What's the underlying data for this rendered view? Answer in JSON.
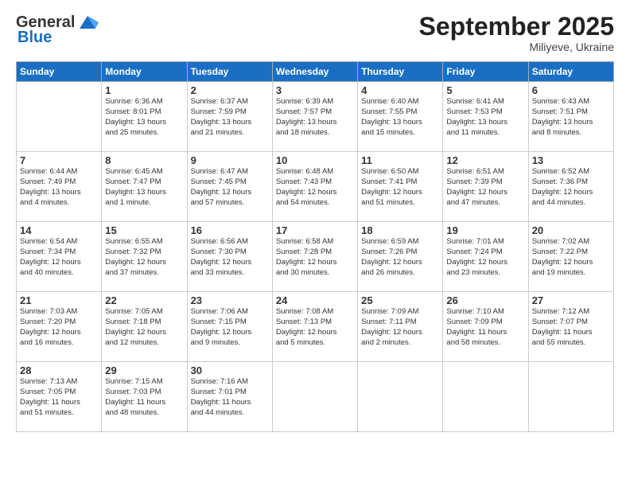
{
  "logo": {
    "general": "General",
    "blue": "Blue"
  },
  "title": "September 2025",
  "subtitle": "Miliyeve, Ukraine",
  "days": [
    "Sunday",
    "Monday",
    "Tuesday",
    "Wednesday",
    "Thursday",
    "Friday",
    "Saturday"
  ],
  "weeks": [
    [
      {
        "day": "",
        "info": ""
      },
      {
        "day": "1",
        "info": "Sunrise: 6:36 AM\nSunset: 8:01 PM\nDaylight: 13 hours\nand 25 minutes."
      },
      {
        "day": "2",
        "info": "Sunrise: 6:37 AM\nSunset: 7:59 PM\nDaylight: 13 hours\nand 21 minutes."
      },
      {
        "day": "3",
        "info": "Sunrise: 6:39 AM\nSunset: 7:57 PM\nDaylight: 13 hours\nand 18 minutes."
      },
      {
        "day": "4",
        "info": "Sunrise: 6:40 AM\nSunset: 7:55 PM\nDaylight: 13 hours\nand 15 minutes."
      },
      {
        "day": "5",
        "info": "Sunrise: 6:41 AM\nSunset: 7:53 PM\nDaylight: 13 hours\nand 11 minutes."
      },
      {
        "day": "6",
        "info": "Sunrise: 6:43 AM\nSunset: 7:51 PM\nDaylight: 13 hours\nand 8 minutes."
      }
    ],
    [
      {
        "day": "7",
        "info": "Sunrise: 6:44 AM\nSunset: 7:49 PM\nDaylight: 13 hours\nand 4 minutes."
      },
      {
        "day": "8",
        "info": "Sunrise: 6:45 AM\nSunset: 7:47 PM\nDaylight: 13 hours\nand 1 minute."
      },
      {
        "day": "9",
        "info": "Sunrise: 6:47 AM\nSunset: 7:45 PM\nDaylight: 12 hours\nand 57 minutes."
      },
      {
        "day": "10",
        "info": "Sunrise: 6:48 AM\nSunset: 7:43 PM\nDaylight: 12 hours\nand 54 minutes."
      },
      {
        "day": "11",
        "info": "Sunrise: 6:50 AM\nSunset: 7:41 PM\nDaylight: 12 hours\nand 51 minutes."
      },
      {
        "day": "12",
        "info": "Sunrise: 6:51 AM\nSunset: 7:39 PM\nDaylight: 12 hours\nand 47 minutes."
      },
      {
        "day": "13",
        "info": "Sunrise: 6:52 AM\nSunset: 7:36 PM\nDaylight: 12 hours\nand 44 minutes."
      }
    ],
    [
      {
        "day": "14",
        "info": "Sunrise: 6:54 AM\nSunset: 7:34 PM\nDaylight: 12 hours\nand 40 minutes."
      },
      {
        "day": "15",
        "info": "Sunrise: 6:55 AM\nSunset: 7:32 PM\nDaylight: 12 hours\nand 37 minutes."
      },
      {
        "day": "16",
        "info": "Sunrise: 6:56 AM\nSunset: 7:30 PM\nDaylight: 12 hours\nand 33 minutes."
      },
      {
        "day": "17",
        "info": "Sunrise: 6:58 AM\nSunset: 7:28 PM\nDaylight: 12 hours\nand 30 minutes."
      },
      {
        "day": "18",
        "info": "Sunrise: 6:59 AM\nSunset: 7:26 PM\nDaylight: 12 hours\nand 26 minutes."
      },
      {
        "day": "19",
        "info": "Sunrise: 7:01 AM\nSunset: 7:24 PM\nDaylight: 12 hours\nand 23 minutes."
      },
      {
        "day": "20",
        "info": "Sunrise: 7:02 AM\nSunset: 7:22 PM\nDaylight: 12 hours\nand 19 minutes."
      }
    ],
    [
      {
        "day": "21",
        "info": "Sunrise: 7:03 AM\nSunset: 7:20 PM\nDaylight: 12 hours\nand 16 minutes."
      },
      {
        "day": "22",
        "info": "Sunrise: 7:05 AM\nSunset: 7:18 PM\nDaylight: 12 hours\nand 12 minutes."
      },
      {
        "day": "23",
        "info": "Sunrise: 7:06 AM\nSunset: 7:15 PM\nDaylight: 12 hours\nand 9 minutes."
      },
      {
        "day": "24",
        "info": "Sunrise: 7:08 AM\nSunset: 7:13 PM\nDaylight: 12 hours\nand 5 minutes."
      },
      {
        "day": "25",
        "info": "Sunrise: 7:09 AM\nSunset: 7:11 PM\nDaylight: 12 hours\nand 2 minutes."
      },
      {
        "day": "26",
        "info": "Sunrise: 7:10 AM\nSunset: 7:09 PM\nDaylight: 11 hours\nand 58 minutes."
      },
      {
        "day": "27",
        "info": "Sunrise: 7:12 AM\nSunset: 7:07 PM\nDaylight: 11 hours\nand 55 minutes."
      }
    ],
    [
      {
        "day": "28",
        "info": "Sunrise: 7:13 AM\nSunset: 7:05 PM\nDaylight: 11 hours\nand 51 minutes."
      },
      {
        "day": "29",
        "info": "Sunrise: 7:15 AM\nSunset: 7:03 PM\nDaylight: 11 hours\nand 48 minutes."
      },
      {
        "day": "30",
        "info": "Sunrise: 7:16 AM\nSunset: 7:01 PM\nDaylight: 11 hours\nand 44 minutes."
      },
      {
        "day": "",
        "info": ""
      },
      {
        "day": "",
        "info": ""
      },
      {
        "day": "",
        "info": ""
      },
      {
        "day": "",
        "info": ""
      }
    ]
  ]
}
